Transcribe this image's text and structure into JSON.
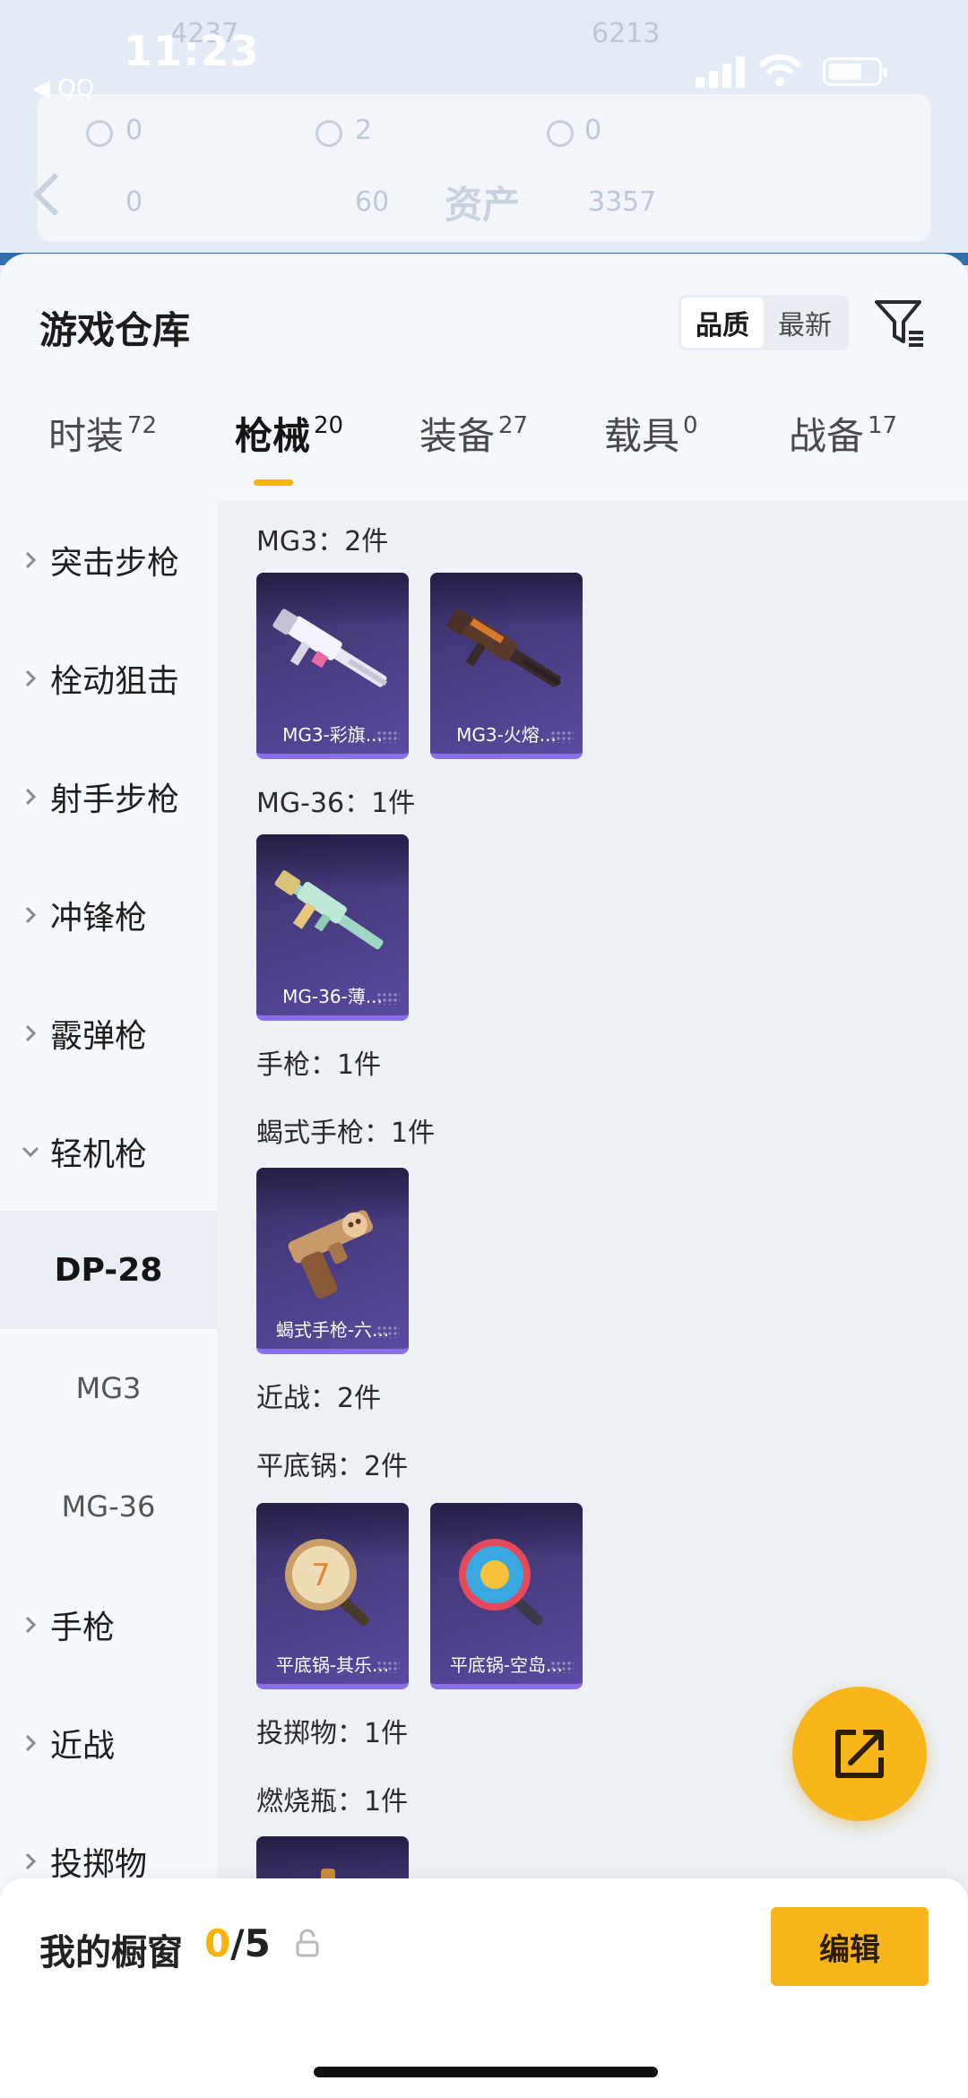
{
  "status_bar": {
    "time": "11:23",
    "back_app": "◀ QQ"
  },
  "background_page": {
    "title": "资产",
    "stats": [
      "4237",
      "6213",
      "0",
      "2",
      "0",
      "0",
      "60",
      "3357"
    ]
  },
  "sheet": {
    "title": "游戏仓库",
    "sort": {
      "quality": "品质",
      "newest": "最新"
    }
  },
  "tabs": [
    {
      "label": "时装",
      "count": "72"
    },
    {
      "label": "枪械",
      "count": "20"
    },
    {
      "label": "装备",
      "count": "27"
    },
    {
      "label": "载具",
      "count": "0"
    },
    {
      "label": "战备",
      "count": "17"
    }
  ],
  "active_tab": "枪械",
  "sidebar": {
    "items": [
      "突击步枪",
      "栓动狙击",
      "射手步枪",
      "冲锋枪",
      "霰弹枪",
      "轻机枪"
    ],
    "sub_items": [
      "DP-28",
      "MG3",
      "MG-36"
    ],
    "items_after": [
      "手枪",
      "近战",
      "投掷物"
    ]
  },
  "content": {
    "groups": [
      {
        "head": "MG3：2件",
        "cards": [
          "MG3-彩旗...",
          "MG3-火熔..."
        ]
      },
      {
        "head": "MG-36：1件",
        "cards": [
          "MG-36-薄..."
        ]
      },
      {
        "head": "手枪：1件"
      },
      {
        "head": "蝎式手枪：1件",
        "cards": [
          "蝎式手枪-六..."
        ]
      },
      {
        "head": "近战：2件"
      },
      {
        "head": "平底锅：2件",
        "cards": [
          "平底锅-其乐...",
          "平底锅-空岛..."
        ]
      },
      {
        "head": "投掷物：1件"
      },
      {
        "head": "燃烧瓶：1件"
      }
    ]
  },
  "bottom_bar": {
    "showcase_label": "我的橱窗",
    "showcase_current": "0",
    "showcase_total": "/5",
    "edit_label": "编辑"
  },
  "colors": {
    "accent": "#f8b61a",
    "card_bg": "#4b3e86",
    "card_border": "#8a6fe6"
  }
}
